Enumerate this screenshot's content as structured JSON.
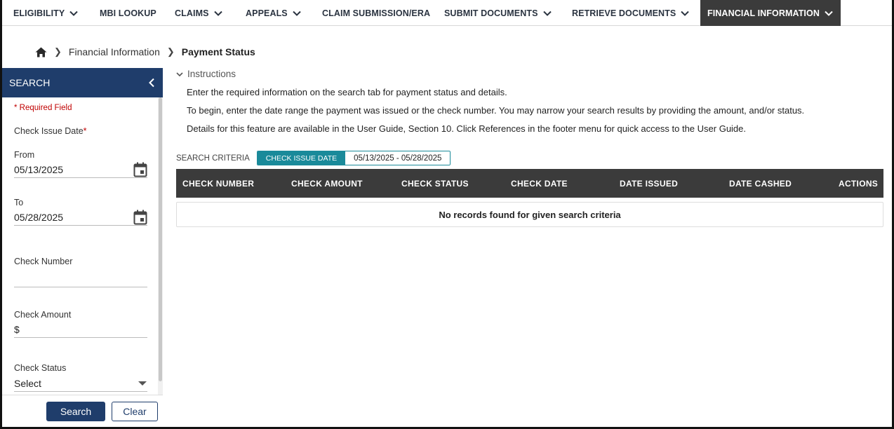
{
  "nav": {
    "items": [
      {
        "label": "ELIGIBILITY",
        "dropdown": true
      },
      {
        "label": "MBI LOOKUP",
        "dropdown": false
      },
      {
        "label": "CLAIMS",
        "dropdown": true
      },
      {
        "label": "APPEALS",
        "dropdown": true
      },
      {
        "label": "CLAIM SUBMISSION/ERA",
        "dropdown": false
      },
      {
        "label": "SUBMIT DOCUMENTS",
        "dropdown": true
      },
      {
        "label": "RETRIEVE DOCUMENTS",
        "dropdown": true
      },
      {
        "label": "FINANCIAL INFORMATION",
        "dropdown": true,
        "active": true
      }
    ]
  },
  "breadcrumb": {
    "home_icon": "home-icon",
    "parent": "Financial Information",
    "current": "Payment Status"
  },
  "sidebar": {
    "title": "SEARCH",
    "required_note": "* Required Field",
    "check_issue_date_label": "Check Issue Date",
    "from_label": "From",
    "from_value": "05/13/2025",
    "to_label": "To",
    "to_value": "05/28/2025",
    "check_number_label": "Check Number",
    "check_number_value": "",
    "check_amount_label": "Check Amount",
    "check_amount_prefix": "$",
    "check_status_label": "Check Status",
    "check_status_value": "Select",
    "search_button": "Search",
    "clear_button": "Clear"
  },
  "instructions": {
    "toggle_label": "Instructions",
    "lines": [
      "Enter the required information on the search tab for payment status and details.",
      "To begin, enter the date range the payment was issued or the check number. You may narrow your search results by providing the amount, and/or status.",
      "Details for this feature are available in the User Guide, Section 10. Click References in the footer menu for quick access to the User Guide."
    ]
  },
  "criteria": {
    "label": "SEARCH CRITERIA",
    "chip_key": "CHECK ISSUE DATE",
    "chip_value": "05/13/2025 - 05/28/2025"
  },
  "table": {
    "columns": [
      "CHECK NUMBER",
      "CHECK AMOUNT",
      "CHECK STATUS",
      "CHECK DATE",
      "DATE ISSUED",
      "DATE CASHED",
      "ACTIONS"
    ],
    "empty_message": "No records found for given search criteria"
  },
  "colors": {
    "primary": "#1f3d6b",
    "nav_active": "#3b3b3b",
    "chip": "#1a8a9a",
    "required": "#c00000"
  }
}
